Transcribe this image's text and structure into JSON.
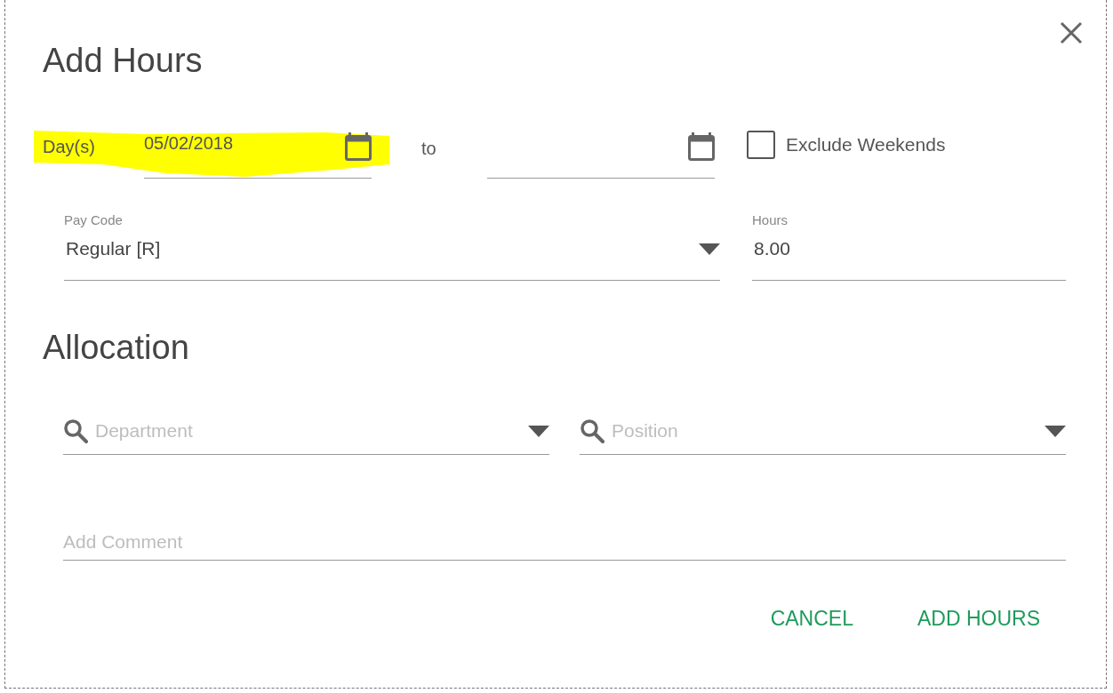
{
  "dialog": {
    "title": "Add Hours"
  },
  "date_range": {
    "label": "Day(s)",
    "highlighted": true,
    "from": {
      "value": "05/02/2018"
    },
    "separator": "to",
    "exclude_weekends": {
      "label": "Exclude Weekends",
      "checked": false
    }
  },
  "pay_code": {
    "label": "Pay Code",
    "value": "Regular [R]"
  },
  "hours": {
    "label": "Hours",
    "value": "8.00"
  },
  "allocation": {
    "title": "Allocation",
    "department": {
      "placeholder": "Department"
    },
    "position": {
      "placeholder": "Position"
    }
  },
  "comment": {
    "placeholder": "Add Comment"
  },
  "buttons": [
    {
      "label": "CANCEL"
    },
    {
      "label": "ADD HOURS"
    }
  ]
}
